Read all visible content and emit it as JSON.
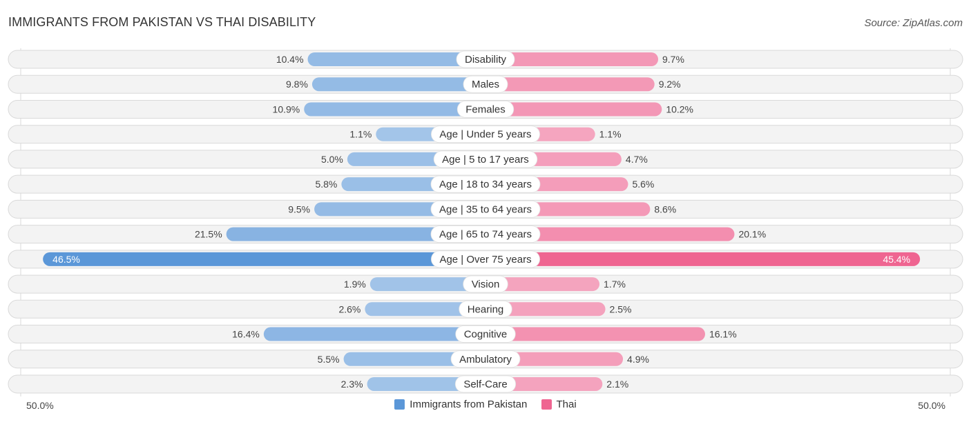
{
  "header": {
    "title": "IMMIGRANTS FROM PAKISTAN VS THAI DISABILITY",
    "source": "Source: ZipAtlas.com"
  },
  "colors": {
    "pakistan_light": "#a9c8ea",
    "pakistan_dark": "#5b97d8",
    "thai_light": "#f5aac3",
    "thai_dark": "#ef6591"
  },
  "chart_data": {
    "type": "bar",
    "orientation": "horizontal-diverging",
    "title": "IMMIGRANTS FROM PAKISTAN VS THAI DISABILITY",
    "xlabel": "",
    "ylabel": "",
    "xlim": [
      -50,
      50
    ],
    "axis_tick_labels": {
      "left": "50.0%",
      "right": "50.0%"
    },
    "legend": {
      "placement": "bottom-center",
      "entries": [
        "Immigrants from Pakistan",
        "Thai"
      ]
    },
    "categories": [
      "Disability",
      "Males",
      "Females",
      "Age | Under 5 years",
      "Age | 5 to 17 years",
      "Age | 18 to 34 years",
      "Age | 35 to 64 years",
      "Age | 65 to 74 years",
      "Age | Over 75 years",
      "Vision",
      "Hearing",
      "Cognitive",
      "Ambulatory",
      "Self-Care"
    ],
    "series": [
      {
        "name": "Immigrants from Pakistan",
        "side": "left",
        "values": [
          10.4,
          9.8,
          10.9,
          1.1,
          5.0,
          5.8,
          9.5,
          21.5,
          46.5,
          1.9,
          2.6,
          16.4,
          5.5,
          2.3
        ],
        "labels": [
          "10.4%",
          "9.8%",
          "10.9%",
          "1.1%",
          "5.0%",
          "5.8%",
          "9.5%",
          "21.5%",
          "46.5%",
          "1.9%",
          "2.6%",
          "16.4%",
          "5.5%",
          "2.3%"
        ]
      },
      {
        "name": "Thai",
        "side": "right",
        "values": [
          9.7,
          9.2,
          10.2,
          1.1,
          4.7,
          5.6,
          8.6,
          20.1,
          45.4,
          1.7,
          2.5,
          16.1,
          4.9,
          2.1
        ],
        "labels": [
          "9.7%",
          "9.2%",
          "10.2%",
          "1.1%",
          "4.7%",
          "5.6%",
          "8.6%",
          "20.1%",
          "45.4%",
          "1.7%",
          "2.5%",
          "16.1%",
          "4.9%",
          "2.1%"
        ]
      }
    ]
  }
}
